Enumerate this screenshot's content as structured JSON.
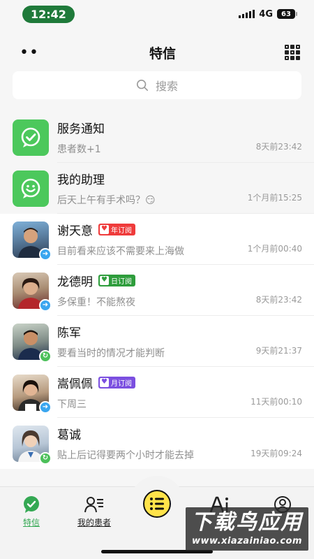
{
  "status": {
    "time": "12:42",
    "network": "4G",
    "battery": "63"
  },
  "header": {
    "title": "特信"
  },
  "search": {
    "placeholder": "搜索"
  },
  "system_items": [
    {
      "name": "服务通知",
      "message": "患者数+1",
      "time": "8天前23:42",
      "icon": "check-chat-icon"
    },
    {
      "name": "我的助理",
      "message": "后天上午有手术吗？😏",
      "time": "1个月前15:25",
      "icon": "smile-chat-icon"
    }
  ],
  "patients": [
    {
      "name": "谢天意",
      "tag": "年订阅",
      "tag_color": "#ef3b3b",
      "message": "目前看来应该不需要来上海做",
      "time": "1个月前00:40",
      "badge": "arrow"
    },
    {
      "name": "龙德明",
      "tag": "日订阅",
      "tag_color": "#2e9d3c",
      "message": "多保重！不能熬夜",
      "time": "8天前23:42",
      "badge": "arrow"
    },
    {
      "name": "陈军",
      "tag": "",
      "message": "要看当时的情况才能判断",
      "time": "9天前21:37",
      "badge": "refresh"
    },
    {
      "name": "嵩佩佩",
      "tag": "月订阅",
      "tag_color": "#7b4fe0",
      "message": "下周三",
      "time": "11天前00:10",
      "badge": "arrow"
    },
    {
      "name": "葛诚",
      "tag": "",
      "message": "贴上后记得要两个小时才能去掉",
      "time": "19天前09:24",
      "badge": "refresh"
    }
  ],
  "tabbar": {
    "tabs": [
      {
        "label": "特信",
        "icon": "check-chat-icon",
        "active": true
      },
      {
        "label": "我的患者",
        "icon": "patients-icon"
      },
      {
        "label": "",
        "icon": "menu-icon"
      },
      {
        "label": "",
        "icon": "ai-icon"
      },
      {
        "label": "",
        "icon": "profile-icon"
      }
    ]
  },
  "watermark": {
    "main": "下载鸟应用",
    "sub": "www.xiazainiao.com"
  }
}
